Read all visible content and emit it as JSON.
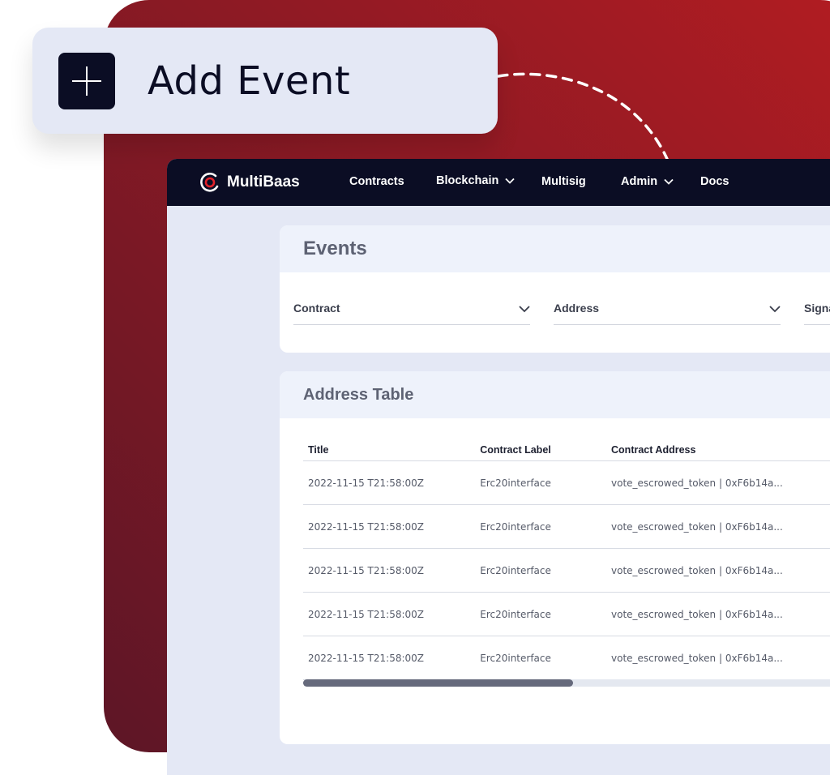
{
  "add_card": {
    "label": "Add Event",
    "icon": "plus-icon"
  },
  "nav": {
    "brand": "MultiBaas",
    "items": [
      {
        "label": "Contracts",
        "dropdown": false
      },
      {
        "label": "Blockchain",
        "dropdown": true
      },
      {
        "label": "Multisig",
        "dropdown": false
      },
      {
        "label": "Admin",
        "dropdown": true
      },
      {
        "label": "Docs",
        "dropdown": false
      }
    ]
  },
  "events": {
    "title": "Events",
    "filters": {
      "contract": "Contract",
      "address": "Address",
      "signature": "Signa"
    }
  },
  "address_table": {
    "title": "Address Table",
    "columns": [
      "Title",
      "Contract Label",
      "Contract Address"
    ],
    "rows": [
      [
        "2022-11-15 T21:58:00Z",
        "Erc20interface",
        "vote_escrowed_token | 0xF6b14a..."
      ],
      [
        "2022-11-15 T21:58:00Z",
        "Erc20interface",
        "vote_escrowed_token | 0xF6b14a..."
      ],
      [
        "2022-11-15 T21:58:00Z",
        "Erc20interface",
        "vote_escrowed_token | 0xF6b14a..."
      ],
      [
        "2022-11-15 T21:58:00Z",
        "Erc20interface",
        "vote_escrowed_token | 0xF6b14a..."
      ],
      [
        "2022-11-15 T21:58:00Z",
        "Erc20interface",
        "vote_escrowed_token | 0xF6b14a..."
      ]
    ],
    "scroll_position_fraction": 0.48
  },
  "colors": {
    "brand_red": "#b21c22",
    "navy": "#0b0d24",
    "panel_bg": "#e4e8f5"
  }
}
